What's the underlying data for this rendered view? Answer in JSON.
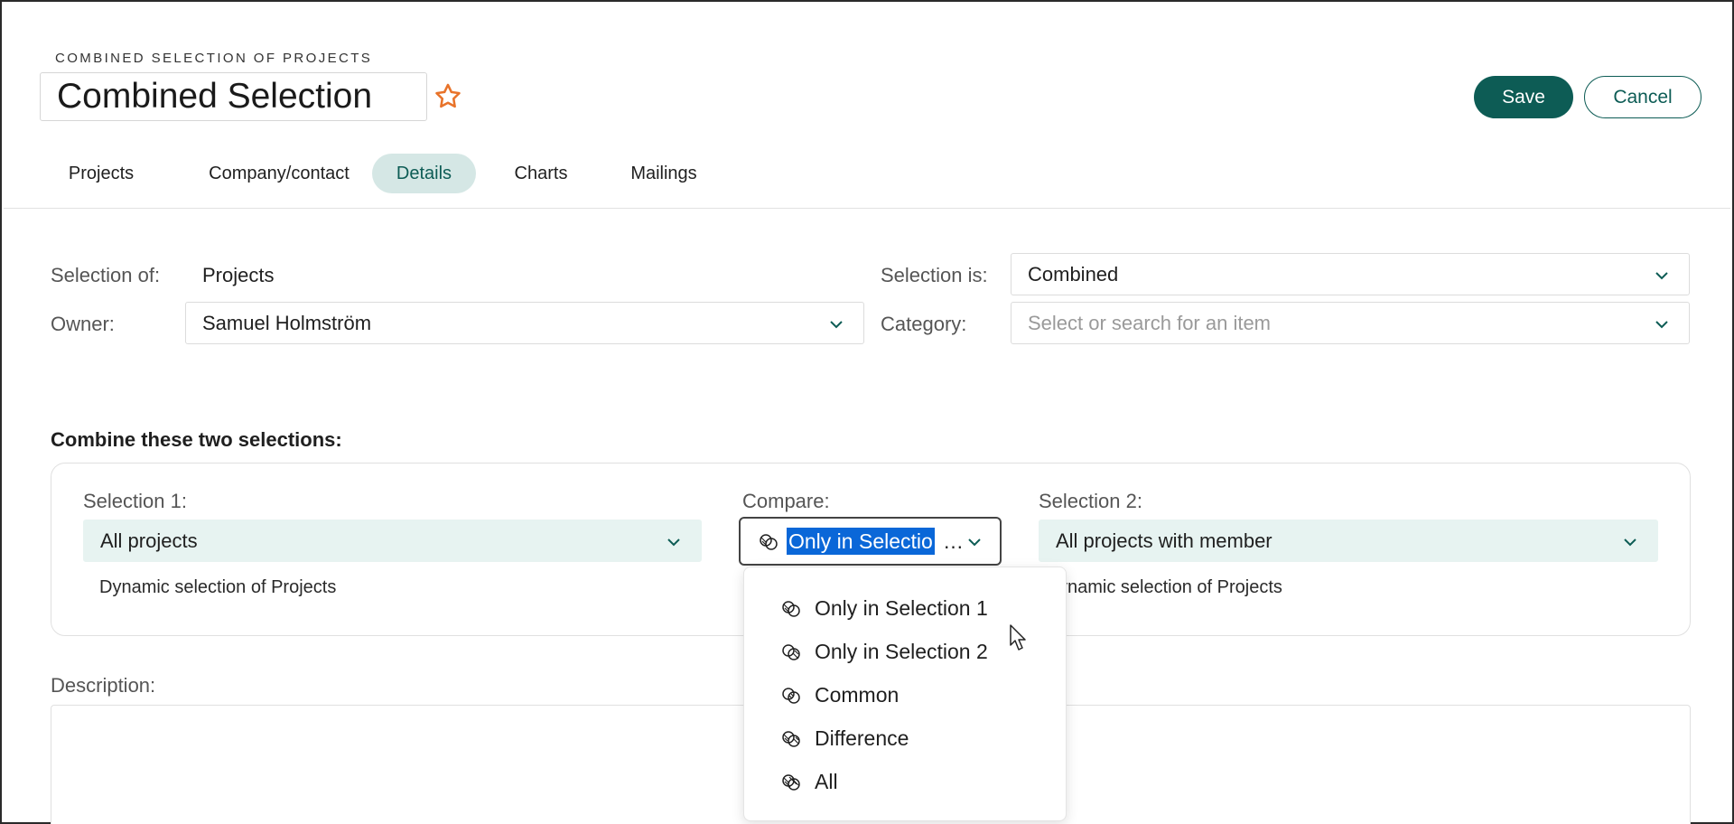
{
  "header": {
    "eyebrow": "COMBINED SELECTION OF PROJECTS",
    "title": "Combined Selection",
    "favorite_icon": "star-outline-icon",
    "save_label": "Save",
    "cancel_label": "Cancel"
  },
  "tabs": [
    {
      "label": "Projects",
      "active": false
    },
    {
      "label": "Company/contact",
      "active": false
    },
    {
      "label": "Details",
      "active": true
    },
    {
      "label": "Charts",
      "active": false
    },
    {
      "label": "Mailings",
      "active": false
    }
  ],
  "details": {
    "selection_of_label": "Selection of:",
    "selection_of_value": "Projects",
    "owner_label": "Owner:",
    "owner_value": "Samuel Holmström",
    "selection_is_label": "Selection is:",
    "selection_is_value": "Combined",
    "category_label": "Category:",
    "category_placeholder": "Select or search for an item"
  },
  "combine": {
    "title": "Combine these two selections:",
    "selection1_label": "Selection 1:",
    "selection1_value": "All projects",
    "selection1_note": "Dynamic selection of Projects",
    "compare_label": "Compare:",
    "compare_value": "Only in Selectio",
    "compare_ellipsis": "…",
    "selection2_label": "Selection 2:",
    "selection2_value": "All projects with member",
    "selection2_note": "ynamic selection of Projects"
  },
  "description": {
    "label": "Description:"
  },
  "compare_options": [
    {
      "label": "Only in Selection 1",
      "icon": "venn-left-icon"
    },
    {
      "label": "Only in Selection 2",
      "icon": "venn-right-icon"
    },
    {
      "label": "Common",
      "icon": "venn-intersection-icon"
    },
    {
      "label": "Difference",
      "icon": "venn-difference-icon"
    },
    {
      "label": "All",
      "icon": "venn-union-icon"
    }
  ],
  "colors": {
    "accent": "#0d5c55",
    "tab_active_bg": "#d5e7e5",
    "select_teal_bg": "#e7f3f1",
    "text_selection": "#0a67d8",
    "star": "#e8732a"
  }
}
